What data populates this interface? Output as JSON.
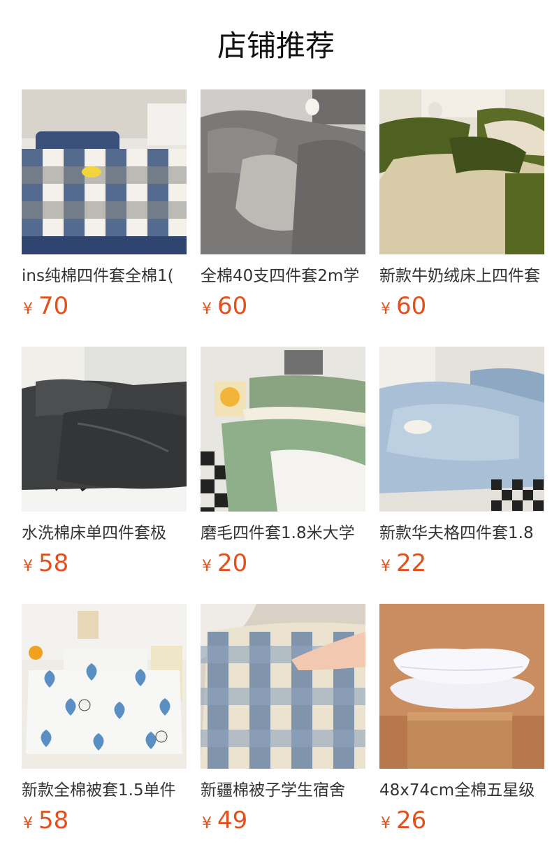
{
  "header": {
    "title": "店铺推荐"
  },
  "currency_symbol": "¥",
  "products": [
    {
      "name": "ins纯棉四件套全棉1(",
      "price": "70",
      "icon": "blue-checkered-bedding-image"
    },
    {
      "name": "全棉40支四件套2m学",
      "price": "60",
      "icon": "gray-bedding-image"
    },
    {
      "name": "新款牛奶绒床上四件套",
      "price": "60",
      "icon": "olive-velvet-bedding-image"
    },
    {
      "name": "水洗棉床单四件套极",
      "price": "58",
      "icon": "charcoal-bedding-image"
    },
    {
      "name": "磨毛四件套1.8米大学",
      "price": "20",
      "icon": "sage-green-bedding-image"
    },
    {
      "name": "新款华夫格四件套1.8",
      "price": "22",
      "icon": "light-blue-waffle-bedding-image"
    },
    {
      "name": "新款全棉被套1.5单件",
      "price": "58",
      "icon": "heart-print-duvet-image"
    },
    {
      "name": "新疆棉被子学生宿舍",
      "price": "49",
      "icon": "plaid-quilt-image"
    },
    {
      "name": "48x74cm全棉五星级",
      "price": "26",
      "icon": "white-pillows-image"
    }
  ],
  "colors": {
    "price": "#e2501c",
    "title": "#111111"
  }
}
